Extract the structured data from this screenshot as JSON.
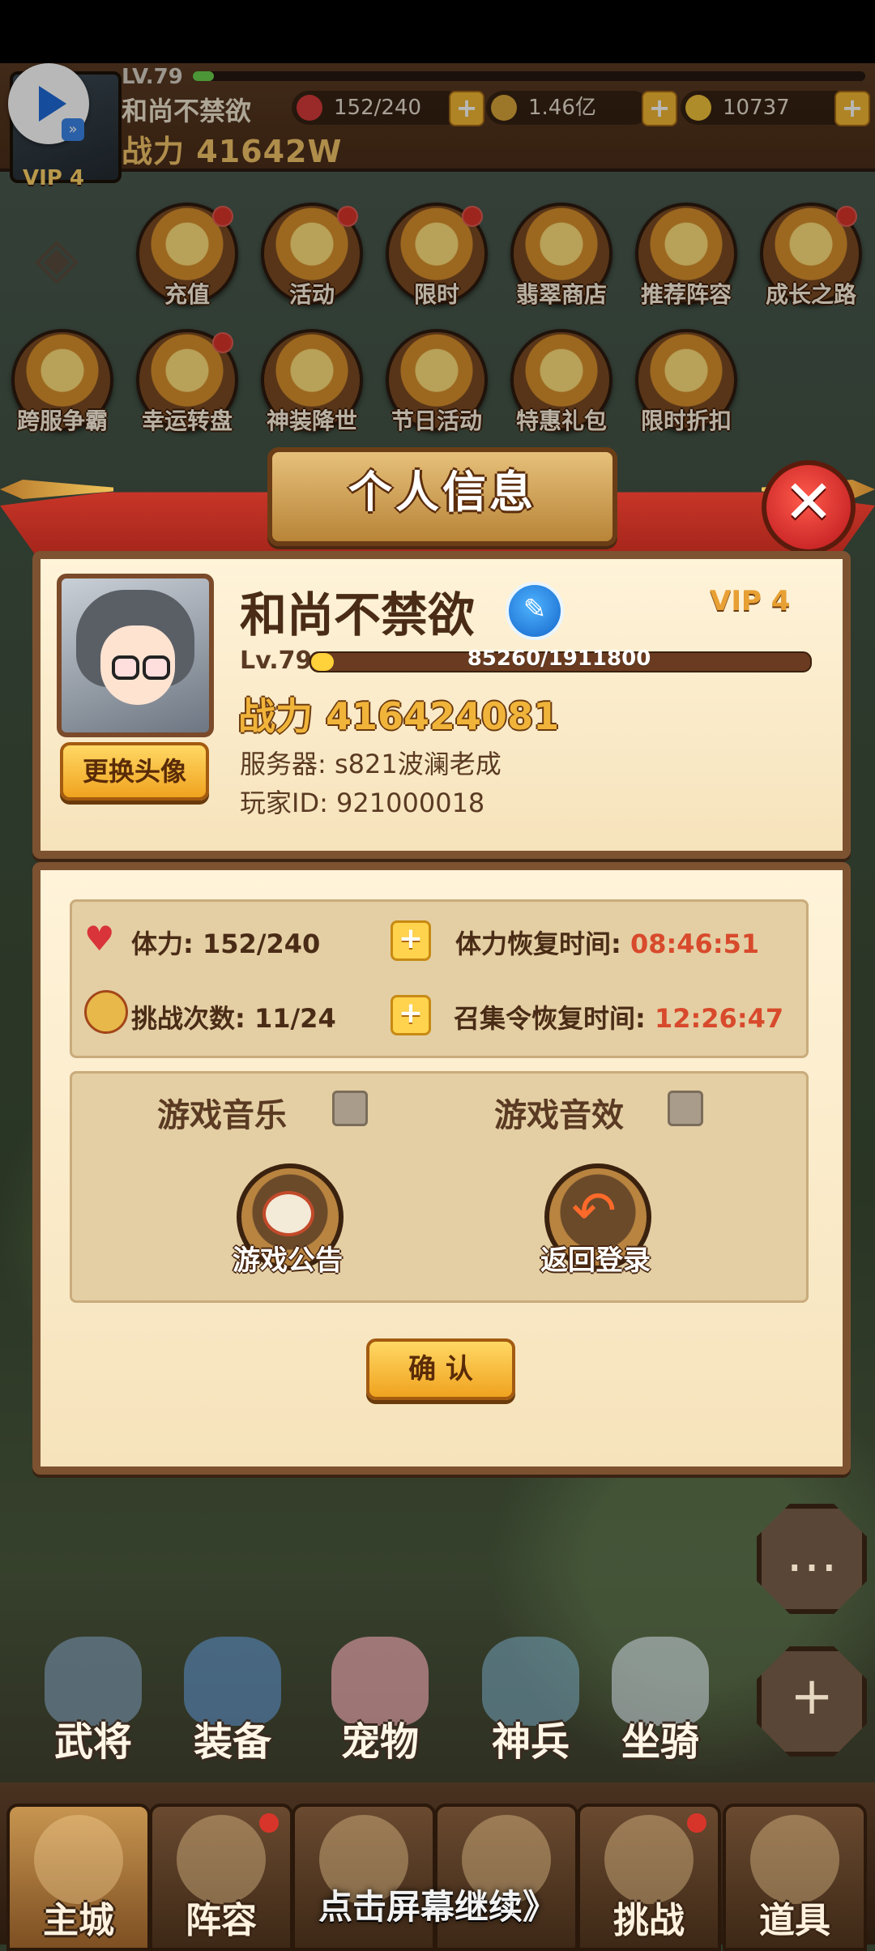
{
  "colors": {
    "accent_red": "#d84a2c",
    "power_gold": "#f0b43a",
    "brown_text": "#5a3a22"
  },
  "hud": {
    "level": "LV.79",
    "name": "和尚不禁欲",
    "power_label": "战力",
    "power_value": "41642W",
    "vip": "VIP 4",
    "stamina": "152/240",
    "coins": "1.46亿",
    "gold": "10737"
  },
  "menu_row1": [
    "充值",
    "活动",
    "限时",
    "翡翠商店",
    "推荐阵容",
    "成长之路"
  ],
  "menu_row2": [
    "跨服争霸",
    "幸运转盘",
    "神装降世",
    "节日活动",
    "特惠礼包",
    "限时折扣"
  ],
  "dialog": {
    "title": "个人信息",
    "close_glyph": "✕",
    "profile": {
      "name": "和尚不禁欲",
      "vip": "VIP 4",
      "level": "Lv.79",
      "xp": "85260/1911800",
      "xp_fraction": 0.045,
      "power_label": "战力",
      "power_value": "416424081",
      "server_label": "服务器:",
      "server_value": "s821波澜老成",
      "player_id_label": "玩家ID:",
      "player_id_value": "921000018",
      "change_avatar": "更换头像"
    },
    "stats": {
      "stamina_label": "体力:",
      "stamina_value": "152/240",
      "stamina_recover_label": "体力恢复时间:",
      "stamina_recover_time": "08:46:51",
      "challenge_label": "挑战次数:",
      "challenge_value": "11/24",
      "summon_recover_label": "召集令恢复时间:",
      "summon_recover_time": "12:26:47"
    },
    "settings": {
      "music_label": "游戏音乐",
      "sound_label": "游戏音效",
      "notice_label": "游戏公告",
      "back_login_label": "返回登录"
    },
    "confirm": "确 认"
  },
  "side_nav": [
    "武将",
    "装备",
    "宠物",
    "神兵",
    "坐骑"
  ],
  "bottom_tabs": [
    "主城",
    "阵容",
    "",
    "",
    "挑战",
    "道具"
  ],
  "continue_text": "点击屏幕继续》"
}
